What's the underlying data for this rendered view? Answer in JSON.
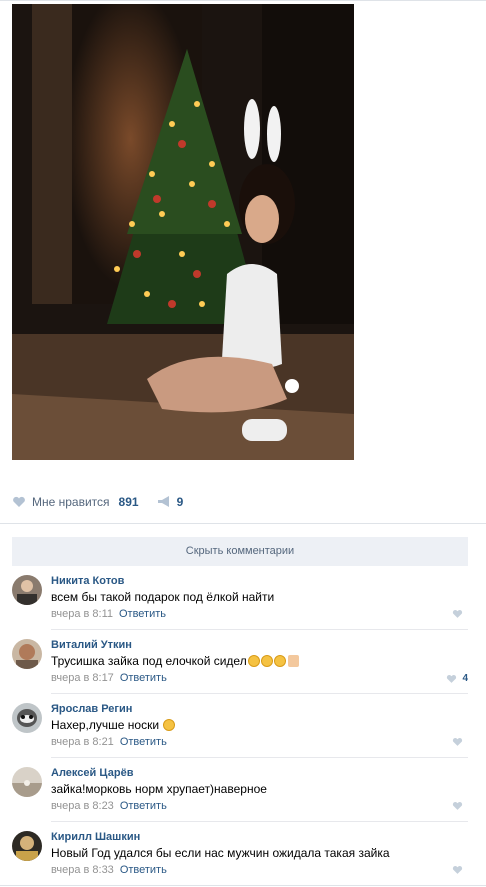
{
  "post": {
    "photo_icon": "photo-of-woman-in-bunny-costume-by-christmas-tree",
    "likes_label": "Мне нравится",
    "likes_count": "891",
    "shares_count": "9"
  },
  "comments_toggle": "Скрыть комментарии",
  "comments": [
    {
      "author": "Никита Котов",
      "text": "всем бы такой подарок под ёлкой найти",
      "time": "вчера в 8:11",
      "reply": "Ответить",
      "likes": ""
    },
    {
      "author": "Виталий Уткин",
      "text": "Трусишка зайка под елочкой сидел",
      "time": "вчера в 8:17",
      "reply": "Ответить",
      "likes": "4"
    },
    {
      "author": "Ярослав Регин",
      "text": "Нахер,лучше носки",
      "time": "вчера в 8:21",
      "reply": "Ответить",
      "likes": ""
    },
    {
      "author": "Алексей Царёв",
      "text": "зайка!морковь норм хрупает)наверное",
      "time": "вчера в 8:23",
      "reply": "Ответить",
      "likes": ""
    },
    {
      "author": "Кирилл Шашкин",
      "text": "Новый Год удался бы если нас мужчин ожидала такая зайка",
      "time": "вчера в 8:33",
      "reply": "Ответить",
      "likes": ""
    }
  ],
  "colors": {
    "link": "#2a5885",
    "muted": "#939393",
    "toggle_bg": "#edf0f5"
  }
}
